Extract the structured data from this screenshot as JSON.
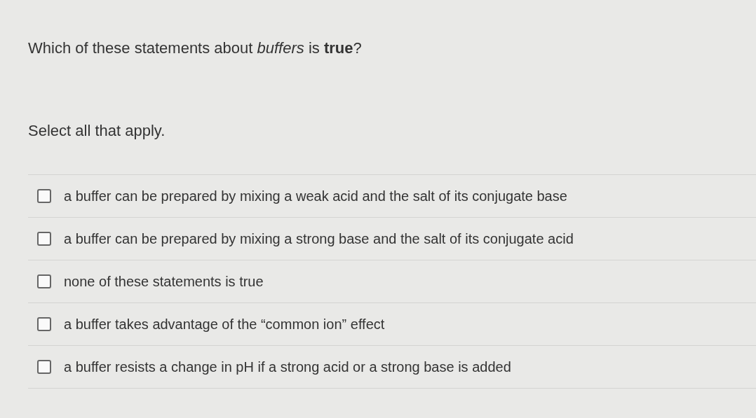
{
  "question": "Which of these statements about *buffers* is **true**?",
  "instruction": "Select all that apply.",
  "options": [
    {
      "label": "a buffer can be prepared by mixing a weak acid and the salt of its conjugate base",
      "checked": false
    },
    {
      "label": "a buffer can be prepared by mixing a strong base and the salt of its conjugate acid",
      "checked": false
    },
    {
      "label": "none of these statements is true",
      "checked": false
    },
    {
      "label": "a buffer takes advantage of the “common ion” effect",
      "checked": false
    },
    {
      "label": "a buffer resists a change in pH if a strong acid or a strong base is added",
      "checked": false
    }
  ]
}
